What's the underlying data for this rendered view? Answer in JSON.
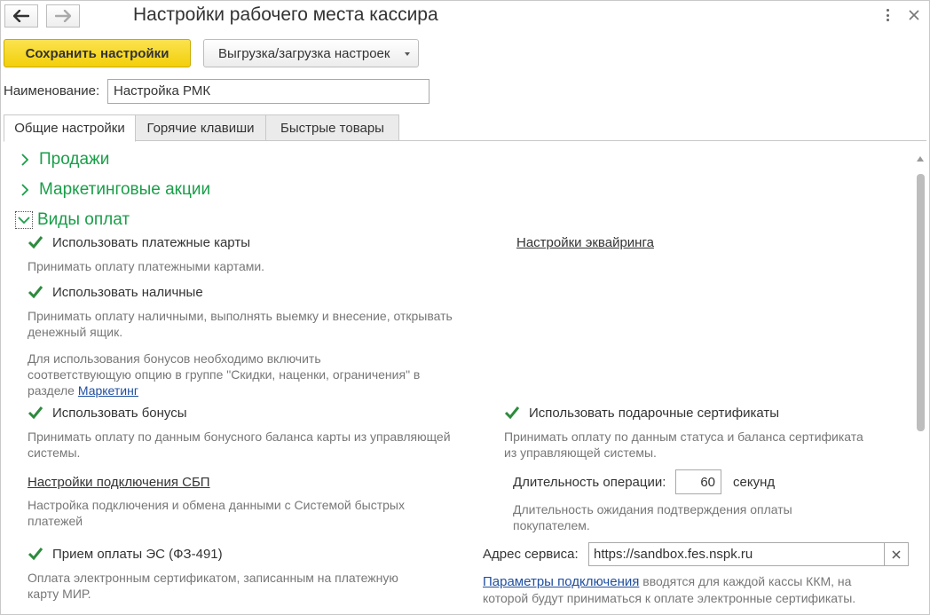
{
  "window": {
    "title": "Настройки рабочего места кассира"
  },
  "toolbar": {
    "save_label": "Сохранить настройки",
    "export_label": "Выгрузка/загрузка настроек"
  },
  "name_field": {
    "label": "Наименование:",
    "value": "Настройка РМК"
  },
  "tabs": [
    {
      "label": "Общие настройки",
      "active": true
    },
    {
      "label": "Горячие клавиши",
      "active": false
    },
    {
      "label": "Быстрые товары",
      "active": false
    }
  ],
  "groups": {
    "sales": "Продажи",
    "marketing": "Маркетинговые акции",
    "payments": "Виды оплат"
  },
  "payments": {
    "cards": {
      "label": "Использовать платежные карты",
      "checked": true,
      "hint": "Принимать оплату платежными картами.",
      "acquiring_link": "Настройки эквайринга"
    },
    "cash": {
      "label": "Использовать наличные",
      "checked": true,
      "hint_line1": "Принимать оплату наличными, выполнять выемку и внесение, открывать",
      "hint_line2": "денежный ящик."
    },
    "bonus_note": {
      "line1": "Для использования бонусов необходимо включить",
      "line2": "соответствующую опцию в группе \"Скидки, наценки, ограничения\" в",
      "line3_prefix": "разделе",
      "line3_link": "Маркетинг"
    },
    "bonuses": {
      "label": "Использовать бонусы",
      "checked": true,
      "hint_line1": "Принимать оплату по данным бонусного баланса карты из управляющей",
      "hint_line2": "системы."
    },
    "gift_certificates": {
      "label": "Использовать подарочные сертификаты",
      "checked": true,
      "hint_line1": "Принимать оплату по данным статуса и баланса сертификата",
      "hint_line2": "из управляющей системы."
    },
    "sbp": {
      "link": "Настройки подключения СБП",
      "hint_line1": "Настройка подключения и обмена данными с Системой быстрых",
      "hint_line2": "платежей"
    },
    "duration": {
      "label": "Длительность операции:",
      "value": "60",
      "unit": "секунд",
      "hint_line1": "Длительность ожидания подтверждения оплаты",
      "hint_line2": "покупателем."
    },
    "es": {
      "label": "Прием оплаты ЭС (ФЗ-491)",
      "checked": true,
      "hint_line1": "Оплата электронным сертификатом, записанным на платежную",
      "hint_line2": "карту МИР."
    },
    "service": {
      "label": "Адрес сервиса:",
      "value": "https://sandbox.fes.nspk.ru",
      "params_link": "Параметры подключения",
      "params_text_line1": " вводятся для каждой кассы ККМ, на",
      "params_text_line2": "которой будут приниматься к оплате электронные сертификаты."
    }
  },
  "colors": {
    "primary_button": "#f3cf0a",
    "group_heading": "#1a9e49",
    "checkmark": "#2e8b3e",
    "link": "#1f4fa0"
  }
}
